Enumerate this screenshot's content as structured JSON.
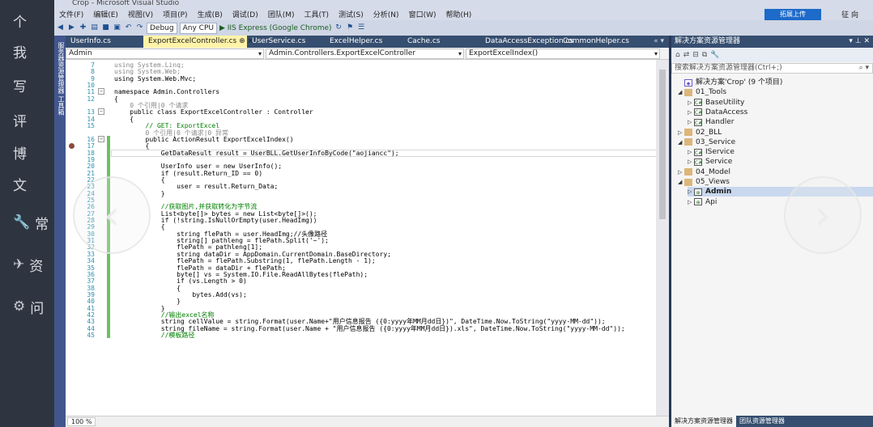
{
  "window": {
    "title": "Crop - Microsoft Visual Studio"
  },
  "overlay": {
    "items": [
      {
        "glyph": "",
        "label": "个"
      },
      {
        "glyph": "",
        "label": "我"
      },
      {
        "glyph": "",
        "label": "写"
      },
      {
        "glyph": "",
        "label": "评"
      },
      {
        "glyph": "",
        "label": "博"
      },
      {
        "glyph": "",
        "label": "文"
      },
      {
        "glyph": "🔧",
        "label": "常"
      },
      {
        "glyph": "✈",
        "label": "资"
      },
      {
        "glyph": "⚙",
        "label": "问"
      }
    ]
  },
  "menu": [
    "文件(F)",
    "编辑(E)",
    "视图(V)",
    "项目(P)",
    "生成(B)",
    "调试(D)",
    "团队(M)",
    "工具(T)",
    "测试(S)",
    "分析(N)",
    "窗口(W)",
    "帮助(H)"
  ],
  "toolbar": {
    "config": "Debug",
    "platform": "Any CPU",
    "run": "▶ IIS Express (Google Chrome)",
    "share": "拓展上传",
    "signin": "征 向"
  },
  "vstrip": "服务器资源管理器 工具箱",
  "tabs": [
    {
      "label": "UserInfo.cs",
      "active": false
    },
    {
      "label": "ExportExcelController.cs ⊕ ×",
      "active": true
    },
    {
      "label": "UserService.cs",
      "active": false
    },
    {
      "label": "ExcelHelper.cs",
      "active": false
    },
    {
      "label": "Cache.cs",
      "active": false
    },
    {
      "label": "DataAccessException.cs",
      "active": false
    },
    {
      "label": "CommonHelper.cs",
      "active": false
    }
  ],
  "nav": {
    "project": "Admin",
    "class": "Admin.Controllers.ExportExcelController",
    "member": "ExportExcelIndex()"
  },
  "code": [
    {
      "n": "7",
      "t": "using System.Linq;",
      "c": "rf"
    },
    {
      "n": "8",
      "t": "using System.Web;",
      "c": "rf"
    },
    {
      "n": "9",
      "t": "using System.Web.Mvc;",
      "c": ""
    },
    {
      "n": "10",
      "t": "",
      "c": ""
    },
    {
      "n": "11",
      "t": "namespace Admin.Controllers",
      "c": ""
    },
    {
      "n": "12",
      "t": "{",
      "c": ""
    },
    {
      "n": "",
      "t": "    0 个引用|0 个请求",
      "c": "rf"
    },
    {
      "n": "13",
      "t": "    public class ExportExcelController : Controller",
      "c": ""
    },
    {
      "n": "14",
      "t": "    {",
      "c": ""
    },
    {
      "n": "15",
      "t": "        // GET: ExportExcel",
      "c": "cm"
    },
    {
      "n": "",
      "t": "        0 个引用|0 个请求|0 异常",
      "c": "rf"
    },
    {
      "n": "16",
      "t": "        public ActionResult ExportExcelIndex()",
      "c": ""
    },
    {
      "n": "17",
      "t": "        {",
      "c": ""
    },
    {
      "n": "18",
      "t": "            GetDataResult result = UserBLL.GetUserInfoByCode(\"aojiancc\");",
      "c": ""
    },
    {
      "n": "19",
      "t": "",
      "c": ""
    },
    {
      "n": "20",
      "t": "            UserInfo user = new UserInfo();",
      "c": ""
    },
    {
      "n": "21",
      "t": "            if (result.Return_ID == 0)",
      "c": ""
    },
    {
      "n": "22",
      "t": "            {",
      "c": ""
    },
    {
      "n": "23",
      "t": "                user = result.Return_Data;",
      "c": ""
    },
    {
      "n": "24",
      "t": "            }",
      "c": ""
    },
    {
      "n": "25",
      "t": "",
      "c": ""
    },
    {
      "n": "26",
      "t": "            //获取图片,并获取转化为字节流",
      "c": "cm"
    },
    {
      "n": "27",
      "t": "            List<byte[]> bytes = new List<byte[]>();",
      "c": ""
    },
    {
      "n": "28",
      "t": "            if (!string.IsNullOrEmpty(user.HeadImg))",
      "c": ""
    },
    {
      "n": "29",
      "t": "            {",
      "c": ""
    },
    {
      "n": "30",
      "t": "                string flePath = user.HeadImg;//头像路径",
      "c": ""
    },
    {
      "n": "31",
      "t": "                string[] pathleng = flePath.Split('~');",
      "c": ""
    },
    {
      "n": "32",
      "t": "                flePath = pathleng[1];",
      "c": ""
    },
    {
      "n": "33",
      "t": "                string dataDir = AppDomain.CurrentDomain.BaseDirectory;",
      "c": ""
    },
    {
      "n": "34",
      "t": "                flePath = flePath.Substring(1, flePath.Length - 1);",
      "c": ""
    },
    {
      "n": "35",
      "t": "                flePath = dataDir + flePath;",
      "c": ""
    },
    {
      "n": "36",
      "t": "                byte[] vs = System.IO.File.ReadAllBytes(flePath);",
      "c": ""
    },
    {
      "n": "37",
      "t": "                if (vs.Length > 0)",
      "c": ""
    },
    {
      "n": "38",
      "t": "                {",
      "c": ""
    },
    {
      "n": "39",
      "t": "                    bytes.Add(vs);",
      "c": ""
    },
    {
      "n": "40",
      "t": "                }",
      "c": ""
    },
    {
      "n": "41",
      "t": "            }",
      "c": ""
    },
    {
      "n": "42",
      "t": "            //输出excel名称",
      "c": "cm"
    },
    {
      "n": "43",
      "t": "            string cellValue = string.Format(user.Name+\"用户信息报告 ({0:yyyy年MM月dd日})\", DateTime.Now.ToString(\"yyyy-MM-dd\"));",
      "c": ""
    },
    {
      "n": "44",
      "t": "            string fileName = string.Format(user.Name + \"用户信息报告 ({0:yyyy年MM月dd日}).xls\", DateTime.Now.ToString(\"yyyy-MM-dd\"));",
      "c": ""
    },
    {
      "n": "45",
      "t": "            //模板路径",
      "c": "cm"
    }
  ],
  "zoom": "100 %",
  "solution": {
    "title": "解决方案资源管理器",
    "search": "搜索解决方案资源管理器(Ctrl+;)",
    "nodes": [
      {
        "label": "解决方案'Crop' (9 个项目)",
        "icon": "sln",
        "depth": 0,
        "arrow": ""
      },
      {
        "label": "01_Tools",
        "icon": "fold",
        "depth": 0,
        "arrow": "◢"
      },
      {
        "label": "BaseUtility",
        "icon": "cs",
        "depth": 1,
        "arrow": "▷"
      },
      {
        "label": "DataAccess",
        "icon": "cs",
        "depth": 1,
        "arrow": "▷"
      },
      {
        "label": "Handler",
        "icon": "cs",
        "depth": 1,
        "arrow": "▷"
      },
      {
        "label": "02_BLL",
        "icon": "fold",
        "depth": 0,
        "arrow": "▷"
      },
      {
        "label": "03_Service",
        "icon": "fold",
        "depth": 0,
        "arrow": "◢"
      },
      {
        "label": "IService",
        "icon": "cs",
        "depth": 1,
        "arrow": "▷"
      },
      {
        "label": "Service",
        "icon": "cs",
        "depth": 1,
        "arrow": "▷"
      },
      {
        "label": "04_Model",
        "icon": "fold",
        "depth": 0,
        "arrow": "▷"
      },
      {
        "label": "05_Views",
        "icon": "fold",
        "depth": 0,
        "arrow": "◢"
      },
      {
        "label": "Admin",
        "icon": "web",
        "depth": 1,
        "arrow": "▷"
      },
      {
        "label": "Api",
        "icon": "web",
        "depth": 1,
        "arrow": "▷"
      }
    ],
    "bottom_tabs": [
      "解决方案资源管理器",
      "团队资源管理器"
    ]
  }
}
